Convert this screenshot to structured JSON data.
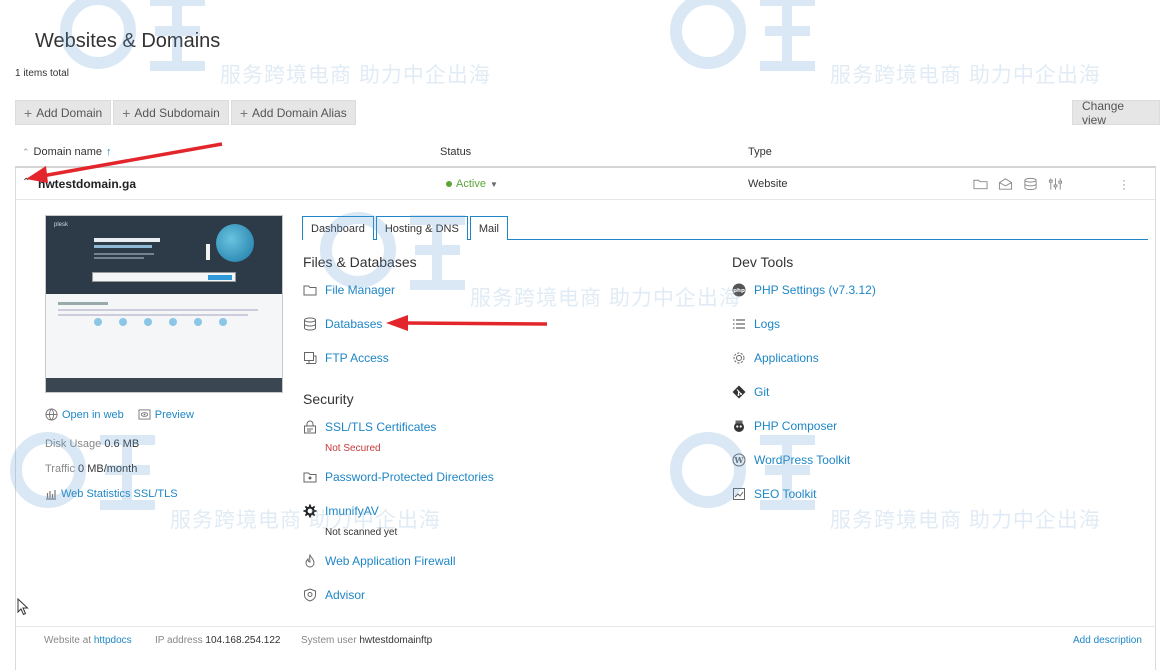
{
  "page": {
    "title": "Websites & Domains",
    "items_total": "1 items total"
  },
  "toolbar": {
    "add_domain": "Add Domain",
    "add_subdomain": "Add Subdomain",
    "add_domain_alias": "Add Domain Alias",
    "change_view": "Change view"
  },
  "columns": {
    "domain_name": "Domain name",
    "status": "Status",
    "type": "Type"
  },
  "domain": {
    "name": "hwtestdomain.ga",
    "status": "Active",
    "type": "Website",
    "open_in_web": "Open in web",
    "preview": "Preview",
    "disk_usage_label": "Disk Usage",
    "disk_usage_value": "0.6 MB",
    "traffic_label": "Traffic",
    "traffic_value": "0 MB/month",
    "web_statistics": "Web Statistics SSL/TLS"
  },
  "tabs": [
    "Dashboard",
    "Hosting & DNS",
    "Mail"
  ],
  "files_databases": {
    "title": "Files & Databases",
    "file_manager": "File Manager",
    "databases": "Databases",
    "ftp_access": "FTP Access"
  },
  "security": {
    "title": "Security",
    "ssl_certificates": "SSL/TLS Certificates",
    "ssl_status": "Not Secured",
    "password_protected": "Password-Protected Directories",
    "imunify": "ImunifyAV",
    "imunify_status": "Not scanned yet",
    "waf": "Web Application Firewall",
    "advisor": "Advisor"
  },
  "dev_tools": {
    "title": "Dev Tools",
    "php_settings": "PHP Settings (v7.3.12)",
    "logs": "Logs",
    "applications": "Applications",
    "git": "Git",
    "php_composer": "PHP Composer",
    "wordpress_toolkit": "WordPress Toolkit",
    "seo_toolkit": "SEO Toolkit"
  },
  "footer": {
    "website_at_label": "Website at",
    "website_at_value": "httpdocs",
    "ip_label": "IP address",
    "ip_value": "104.168.254.122",
    "system_user_label": "System user",
    "system_user_value": "hwtestdomainftp",
    "add_description": "Add description"
  },
  "watermark": {
    "text": "服务跨境电商 助力中企出海"
  },
  "colors": {
    "link": "#1e86c6",
    "active_status": "#5aa538",
    "not_secured": "#c43a3a",
    "annotation_arrow": "#e3262b"
  }
}
